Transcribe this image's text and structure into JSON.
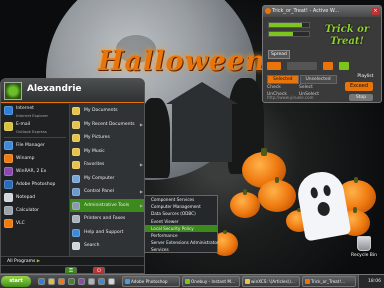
{
  "desktop": {
    "wallpaper_text": "Halloween",
    "recycle_bin_label": "Recycle Bin"
  },
  "trick_widget": {
    "title": "Trick_or_Treat! - Active W...",
    "spread_label": "Spread",
    "logo_text": "Trick or Treat!",
    "playlist_label": "Playlist",
    "tabs": [
      "Selected",
      "Unselected"
    ],
    "options": [
      "Check",
      "Select",
      "UnCheck",
      "UnSelect"
    ],
    "exceed_label": "Exceed",
    "stop_label": "Stop",
    "url": "http://www.yiruele.com",
    "progress": 0.82,
    "accent": "#e8740c",
    "green": "#7cc51c"
  },
  "start_menu": {
    "username": "Alexandrie",
    "pinned": [
      {
        "label": "Internet",
        "sub": "Internet Explorer",
        "icon": "ie-icon",
        "color": "#2f7fd8"
      },
      {
        "label": "E-mail",
        "sub": "Outlook Express",
        "icon": "mail-icon",
        "color": "#d8c23a"
      }
    ],
    "recent": [
      {
        "label": "File Manager",
        "icon": "folder-icon",
        "color": "#3d8ad9"
      },
      {
        "label": "Winamp",
        "icon": "winamp-icon",
        "color": "#ee7a10"
      },
      {
        "label": "WinRAR, 2 Ex",
        "icon": "winrar-icon",
        "color": "#8a4ab0"
      },
      {
        "label": "Adobe Photoshop",
        "icon": "photoshop-icon",
        "color": "#2a6ab8"
      },
      {
        "label": "Notepad",
        "icon": "notepad-icon",
        "color": "#cfd6de"
      },
      {
        "label": "Calculator",
        "icon": "calculator-icon",
        "color": "#9aa3ab"
      },
      {
        "label": "VLC",
        "icon": "vlc-icon",
        "color": "#ee7a10"
      }
    ],
    "all_programs": "All Programs",
    "right_items": [
      {
        "label": "My Documents",
        "icon": "documents-icon",
        "color": "#e8c34a",
        "arrow": ""
      },
      {
        "label": "My Recent Documents",
        "icon": "recent-icon",
        "color": "#e8c34a",
        "arrow": "▶"
      },
      {
        "label": "My Pictures",
        "icon": "pictures-icon",
        "color": "#e8c34a",
        "arrow": ""
      },
      {
        "label": "My Music",
        "icon": "music-icon",
        "color": "#e8c34a",
        "arrow": ""
      },
      {
        "label": "Favorites",
        "icon": "favorites-icon",
        "color": "#e8c34a",
        "arrow": "▶"
      },
      {
        "label": "My Computer",
        "icon": "computer-icon",
        "color": "#7aa8d6",
        "arrow": ""
      },
      {
        "label": "Control Panel",
        "icon": "control-panel-icon",
        "color": "#6a9ad0",
        "arrow": "▶"
      },
      {
        "label": "Administrative Tools",
        "icon": "admin-tools-icon",
        "color": "#8a9aa8",
        "arrow": "▶"
      },
      {
        "label": "Printers and Faxes",
        "icon": "printer-icon",
        "color": "#aab4be",
        "arrow": ""
      },
      {
        "label": "Help and Support",
        "icon": "help-icon",
        "color": "#3d8ad9",
        "arrow": ""
      },
      {
        "label": "Search",
        "icon": "search-icon",
        "color": "#cfd6de",
        "arrow": ""
      }
    ],
    "footer": [
      "Log Off",
      "Turn Off"
    ]
  },
  "submenu": {
    "items": [
      "Component Services",
      "Computer Management",
      "Data Sources (ODBC)",
      "Event Viewer",
      "Local Security Policy",
      "Performance",
      "Server Extensions Administrator",
      "Services"
    ]
  },
  "taskbar": {
    "start_label": "start",
    "buttons": [
      "Adobe Photoshop",
      "Onebuy - Instant M...",
      "winXCS: \\(Articles\\)...",
      "Trick_or_Treat!..."
    ],
    "clock": "18:06"
  }
}
